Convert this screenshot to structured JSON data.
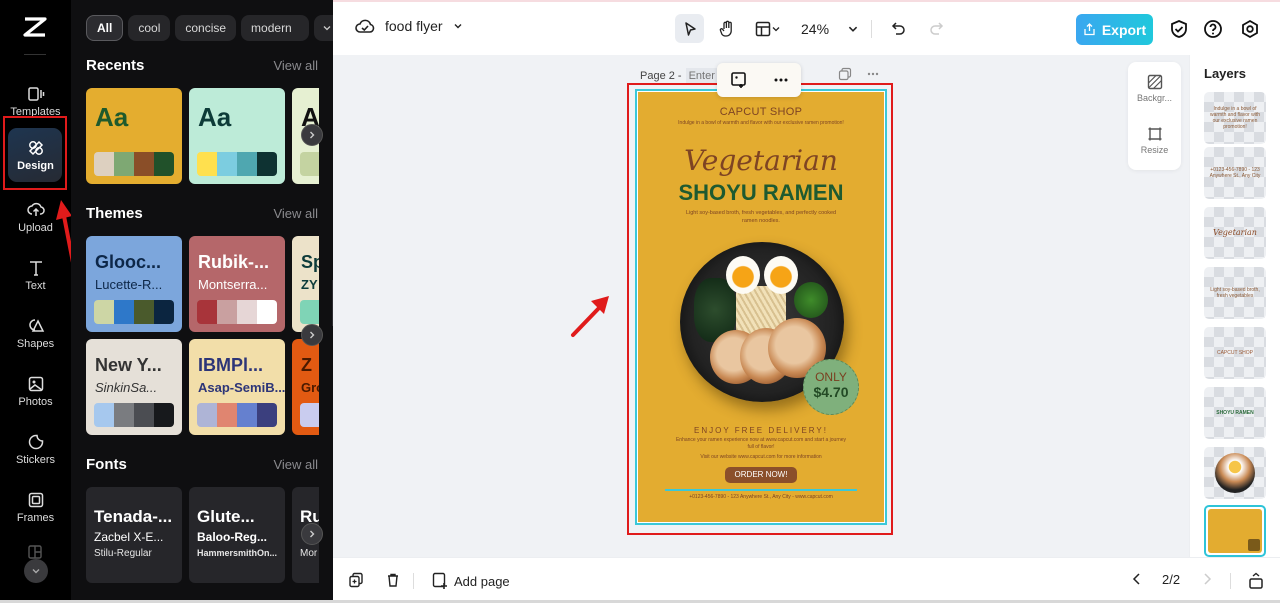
{
  "rail": {
    "items": [
      {
        "label": "Templates",
        "icon": "templates-icon"
      },
      {
        "label": "Design",
        "icon": "design-icon",
        "active": true
      },
      {
        "label": "Upload",
        "icon": "upload-icon"
      },
      {
        "label": "Text",
        "icon": "text-icon"
      },
      {
        "label": "Shapes",
        "icon": "shapes-icon"
      },
      {
        "label": "Photos",
        "icon": "photos-icon"
      },
      {
        "label": "Stickers",
        "icon": "stickers-icon"
      },
      {
        "label": "Frames",
        "icon": "frames-icon"
      }
    ]
  },
  "panel": {
    "chips": [
      "All",
      "cool",
      "concise",
      "modern"
    ],
    "recents": {
      "title": "Recents",
      "view_all": "View all",
      "cards": [
        {
          "text": "Aa",
          "bg": "#e4ad2f",
          "fg": "#1f5a2c",
          "swatches": [
            "#ddd0c0",
            "#7ea873",
            "#8a4e28",
            "#21512a"
          ]
        },
        {
          "text": "Aa",
          "bg": "#bdebd8",
          "fg": "#0d3b38",
          "swatches": [
            "#ffe04e",
            "#7ccde0",
            "#4fa7b0",
            "#0e3232"
          ]
        },
        {
          "text": "A",
          "bg": "#e6f0d2",
          "fg": "#111111",
          "swatches": [
            "#c4d3a1"
          ]
        }
      ]
    },
    "themes": {
      "title": "Themes",
      "view_all": "View all",
      "cards": [
        {
          "t1": "Glooc...",
          "t2": "Lucette-R...",
          "bg": "#7ca6dc",
          "fg": "#0d2748",
          "swatches": [
            "#cdd6a5",
            "#2e78c9",
            "#4a5a2c",
            "#0b2540"
          ]
        },
        {
          "t1": "Rubik-...",
          "t2": "Montserra...",
          "bg": "#b5676a",
          "fg": "#ffffff",
          "swatches": [
            "#a8343a",
            "#c9a0a0",
            "#e6d6d6",
            "#ffffff"
          ]
        },
        {
          "t1": "Sp",
          "t2": "ZY",
          "bg": "#ece2c9",
          "fg": "#0d3b3a",
          "swatches": [
            "#7fd4b6"
          ]
        },
        {
          "t1": "New Y...",
          "t2": "SinkinSa...",
          "bg": "#e5e0d8",
          "fg": "#333333",
          "swatches": [
            "#a6c8ee",
            "#7a7c80",
            "#4b4d52",
            "#17191c"
          ]
        },
        {
          "t1": "IBMPl...",
          "t2": "Asap-SemiB...",
          "bg": "#f2dea9",
          "fg": "#2d3578",
          "swatches": [
            "#aeb4d6",
            "#e08570",
            "#6580cf",
            "#3b3f7e"
          ]
        },
        {
          "t1": "Z",
          "t2": "Gro",
          "bg": "#e25a12",
          "fg": "#4a1a00",
          "swatches": [
            "#c9ccef"
          ]
        }
      ]
    },
    "fonts": {
      "title": "Fonts",
      "view_all": "View all",
      "cards": [
        {
          "f1": "Tenada-...",
          "f2": "Zacbel X-E...",
          "f3": "Stilu-Regular"
        },
        {
          "f1": "Glute...",
          "f2": "Baloo-Reg...",
          "f3": "HammersmithOn..."
        },
        {
          "f1": "Ru",
          "f2": "",
          "f3": "Mor"
        }
      ]
    }
  },
  "topbar": {
    "doc_title": "food flyer",
    "zoom": "24%",
    "export_label": "Export"
  },
  "canvas": {
    "page_label": "Page 2 -",
    "page_title_placeholder": "Enter",
    "side_tools": [
      {
        "label": "Backgr...",
        "icon": "background-icon"
      },
      {
        "label": "Resize",
        "icon": "resize-icon"
      }
    ]
  },
  "flyer": {
    "shop": "CAPCUT SHOP",
    "intro": "Indulge in a bowl of warmth and flavor with our exclusive ramen promotion!",
    "title_script": "Vegetarian",
    "title_main": "SHOYU RAMEN",
    "description": "Light soy-based broth, fresh vegetables, and perfectly cooked ramen noodles.",
    "price_label": "ONLY",
    "price": "$4.70",
    "delivery": "ENJOY FREE DELIVERY!",
    "enhance": "Enhance your ramen experience now at www.capcut.com and start a journey full of flavor!",
    "visit": "Visit our website www.capcut.com for more information",
    "cta": "ORDER NOW!",
    "contact": "+0123-456-7890 - 123 Anywhere St., Any City - www.capcut.com",
    "colors": {
      "background": "#e3ac30",
      "brown": "#7e4423",
      "green": "#1e5a30",
      "accent": "#3bc8d8"
    }
  },
  "layers": {
    "title": "Layers",
    "items": [
      {
        "name": "intro-text-layer",
        "text": "Indulge in a bowl of warmth and flavor with our exclusive ramen promotion!"
      },
      {
        "name": "contact-text-layer",
        "text": "+0123-456-7890 - 123 Anywhere St., Any City"
      },
      {
        "name": "vegetarian-layer",
        "text": "Vegetarian"
      },
      {
        "name": "description-layer",
        "text": "Light soy-based broth, fresh vegetables"
      },
      {
        "name": "capcut-shop-layer",
        "text": "CAPCUT SHOP"
      },
      {
        "name": "shoyu-ramen-layer",
        "text": "SHOYU RAMEN"
      },
      {
        "name": "ramen-image-layer",
        "text": ""
      },
      {
        "name": "background-layer",
        "text": ""
      }
    ]
  },
  "bottombar": {
    "add_page": "Add page",
    "page_counter": "2/2"
  }
}
